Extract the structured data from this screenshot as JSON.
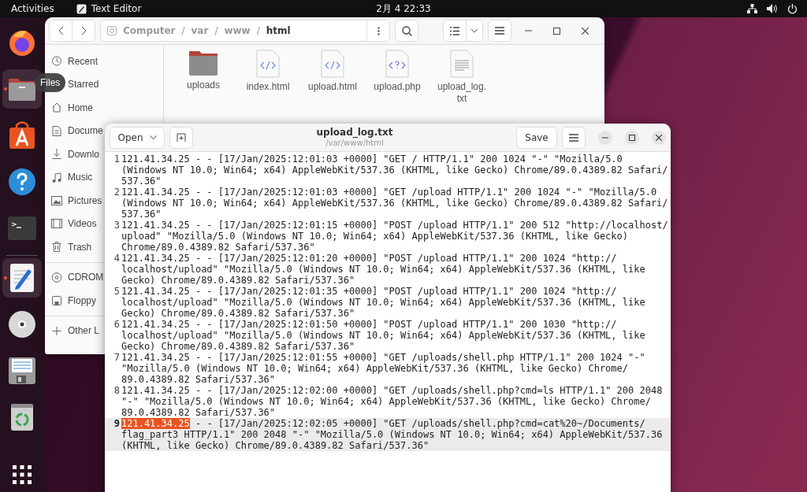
{
  "top_bar": {
    "activities": "Activities",
    "app_name": "Text Editor",
    "clock": "2月 4  22:33"
  },
  "dock": {
    "items": [
      {
        "kind": "firefox",
        "running": false
      },
      {
        "kind": "files",
        "running": true
      },
      {
        "kind": "appstore",
        "running": false
      },
      {
        "kind": "help",
        "running": false
      },
      {
        "kind": "terminal",
        "running": false
      },
      {
        "kind": "editor",
        "running": true
      },
      {
        "kind": "disc",
        "running": false
      },
      {
        "kind": "floppy",
        "running": false
      },
      {
        "kind": "trash",
        "running": false
      }
    ],
    "tooltip": "Files"
  },
  "files_window": {
    "path": {
      "separator": "/",
      "items": [
        {
          "label": "Computer",
          "current": false
        },
        {
          "label": "var",
          "current": false
        },
        {
          "label": "www",
          "current": false
        },
        {
          "label": "html",
          "current": true
        }
      ]
    },
    "sidebar": [
      {
        "kind": "recent",
        "label": "Recent"
      },
      {
        "kind": "starred",
        "label": "Starred"
      },
      {
        "kind": "home",
        "label": "Home"
      },
      {
        "kind": "documents",
        "label": "Docume"
      },
      {
        "kind": "downloads",
        "label": "Downlo"
      },
      {
        "kind": "music",
        "label": "Music"
      },
      {
        "kind": "pictures",
        "label": "Pictures"
      },
      {
        "kind": "videos",
        "label": "Videos"
      },
      {
        "kind": "trash",
        "label": "Trash"
      },
      {
        "kind": "cdrom",
        "label": "CDROM"
      },
      {
        "kind": "floppy",
        "label": "Floppy"
      },
      {
        "kind": "other",
        "label": "Other L"
      }
    ],
    "files": [
      {
        "kind": "folder",
        "name": "uploads"
      },
      {
        "kind": "html",
        "name": "index.html"
      },
      {
        "kind": "html",
        "name": "upload.html"
      },
      {
        "kind": "php",
        "name": "upload.php"
      },
      {
        "kind": "text",
        "name": "upload_log.txt"
      }
    ]
  },
  "editor": {
    "open_button": "Open",
    "title": "upload_log.txt",
    "subtitle": "/var/www/html",
    "save_button": "Save",
    "lines": [
      {
        "number": "1",
        "current": false,
        "text": "121.41.34.25 - - [17/Jan/2025:12:01:03 +0000] \"GET / HTTP/1.1\" 200 1024 \"-\" \"Mozilla/5.0 (Windows NT 10.0; Win64; x64) AppleWebKit/537.36 (KHTML, like Gecko) Chrome/89.0.4389.82 Safari/537.36\""
      },
      {
        "number": "2",
        "current": false,
        "text": "121.41.34.25 - - [17/Jan/2025:12:01:03 +0000] \"GET /upload HTTP/1.1\" 200 1024 \"-\" \"Mozilla/5.0 (Windows NT 10.0; Win64; x64) AppleWebKit/537.36 (KHTML, like Gecko) Chrome/89.0.4389.82 Safari/537.36\""
      },
      {
        "number": "3",
        "current": false,
        "text": "121.41.34.25 - - [17/Jan/2025:12:01:15 +0000] \"POST /upload HTTP/1.1\" 200 512 \"http://localhost/upload\" \"Mozilla/5.0 (Windows NT 10.0; Win64; x64) AppleWebKit/537.36 (KHTML, like Gecko) Chrome/89.0.4389.82 Safari/537.36\""
      },
      {
        "number": "4",
        "current": false,
        "text": "121.41.34.25 - - [17/Jan/2025:12:01:20 +0000] \"POST /upload HTTP/1.1\" 200 1024 \"http://localhost/upload\" \"Mozilla/5.0 (Windows NT 10.0; Win64; x64) AppleWebKit/537.36 (KHTML, like Gecko) Chrome/89.0.4389.82 Safari/537.36\""
      },
      {
        "number": "5",
        "current": false,
        "text": "121.41.34.25 - - [17/Jan/2025:12:01:35 +0000] \"POST /upload HTTP/1.1\" 200 1024 \"http://localhost/upload\" \"Mozilla/5.0 (Windows NT 10.0; Win64; x64) AppleWebKit/537.36 (KHTML, like Gecko) Chrome/89.0.4389.82 Safari/537.36\""
      },
      {
        "number": "6",
        "current": false,
        "text": "121.41.34.25 - - [17/Jan/2025:12:01:50 +0000] \"POST /upload HTTP/1.1\" 200 1030 \"http://localhost/upload\" \"Mozilla/5.0 (Windows NT 10.0; Win64; x64) AppleWebKit/537.36 (KHTML, like Gecko) Chrome/89.0.4389.82 Safari/537.36\""
      },
      {
        "number": "7",
        "current": false,
        "text": "121.41.34.25 - - [17/Jan/2025:12:01:55 +0000] \"GET /uploads/shell.php HTTP/1.1\" 200 1024 \"-\" \"Mozilla/5.0 (Windows NT 10.0; Win64; x64) AppleWebKit/537.36 (KHTML, like Gecko) Chrome/89.0.4389.82 Safari/537.36\""
      },
      {
        "number": "8",
        "current": false,
        "text": "121.41.34.25 - - [17/Jan/2025:12:02:00 +0000] \"GET /uploads/shell.php?cmd=ls HTTP/1.1\" 200 2048 \"-\" \"Mozilla/5.0 (Windows NT 10.0; Win64; x64) AppleWebKit/537.36 (KHTML, like Gecko) Chrome/89.0.4389.82 Safari/537.36\""
      },
      {
        "number": "9",
        "current": true,
        "selected_part": "121.41.34.25",
        "text": " - - [17/Jan/2025:12:02:05 +0000] \"GET /uploads/shell.php?cmd=cat%20~/Documents/flag_part3 HTTP/1.1\" 200 2048 \"-\" \"Mozilla/5.0 (Windows NT 10.0; Win64; x64) AppleWebKit/537.36 (KHTML, like Gecko) Chrome/89.0.4389.82 Safari/537.36\""
      }
    ]
  }
}
